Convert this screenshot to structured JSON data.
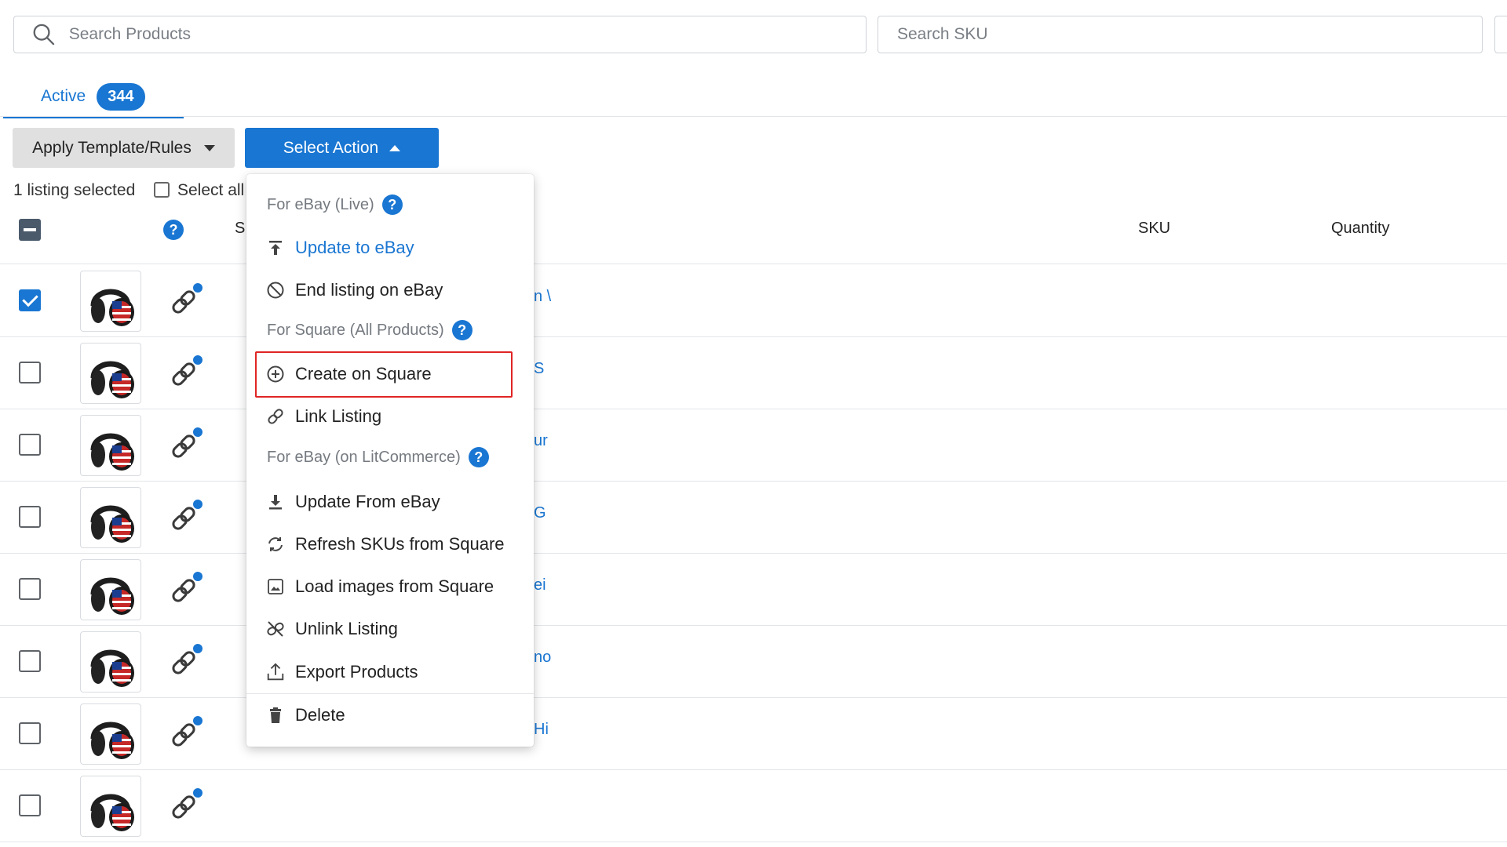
{
  "search": {
    "products_placeholder": "Search Products",
    "sku_placeholder": "Search SKU"
  },
  "tabs": [
    {
      "label": "Active",
      "count": "344"
    }
  ],
  "toolbar": {
    "apply_template_label": "Apply Template/Rules",
    "select_action_label": "Select Action"
  },
  "selection": {
    "status_text": "1 listing selected",
    "select_all_label": "Select all"
  },
  "table": {
    "header_partial": "S",
    "columns": [
      "SKU",
      "Quantity"
    ],
    "rows": [
      {
        "checked": true,
        "peek": "n \\"
      },
      {
        "checked": false,
        "peek": "S"
      },
      {
        "checked": false,
        "peek": "ur"
      },
      {
        "checked": false,
        "peek": "G"
      },
      {
        "checked": false,
        "peek": "ei"
      },
      {
        "checked": false,
        "peek": "no"
      },
      {
        "checked": false,
        "peek": "Hi"
      },
      {
        "checked": false,
        "peek": ""
      }
    ]
  },
  "menu": {
    "groups": {
      "ebay_live": "For eBay (Live)",
      "square_all": "For Square (All Products)",
      "ebay_litcommerce": "For eBay (on LitCommerce)"
    },
    "items": {
      "update_to_ebay": "Update to eBay",
      "end_listing_on_ebay": "End listing on eBay",
      "create_on_square": "Create on Square",
      "link_listing": "Link Listing",
      "update_from_ebay": "Update From eBay",
      "refresh_skus": "Refresh SKUs from Square",
      "load_images": "Load images from Square",
      "unlink_listing": "Unlink Listing",
      "export_products": "Export Products",
      "delete": "Delete"
    }
  },
  "colors": {
    "accent": "#1976d2",
    "highlight": "#e02424"
  }
}
